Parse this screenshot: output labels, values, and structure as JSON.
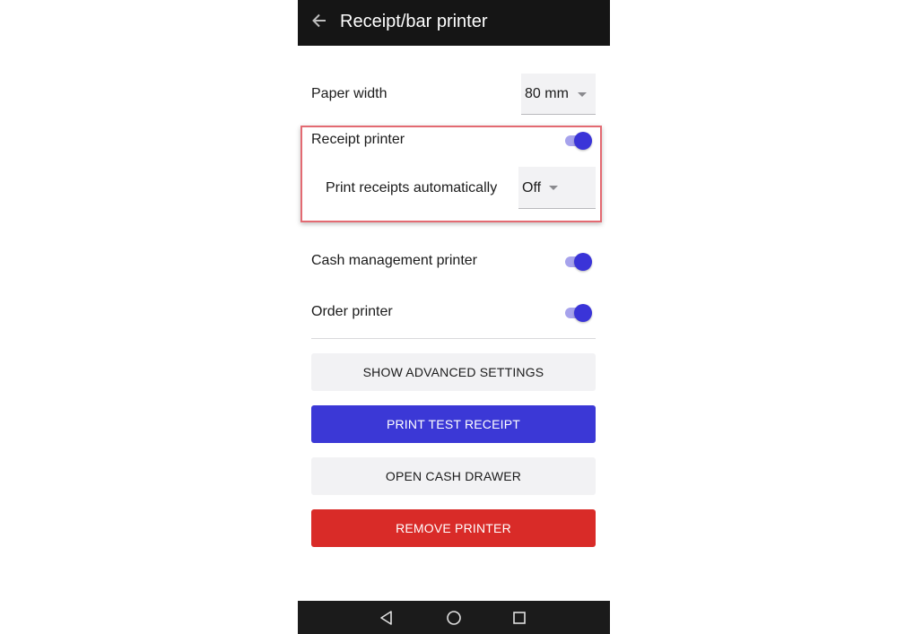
{
  "header": {
    "title": "Receipt/bar printer",
    "back_icon": "arrow-left-icon"
  },
  "paper_width": {
    "label": "Paper width",
    "value": "80 mm"
  },
  "receipt_printer": {
    "label": "Receipt printer",
    "enabled": true,
    "auto_print": {
      "label": "Print receipts automatically",
      "value": "Off"
    }
  },
  "cash_management_printer": {
    "label": "Cash management printer",
    "enabled": true
  },
  "order_printer": {
    "label": "Order printer",
    "enabled": true
  },
  "buttons": {
    "show_advanced": "SHOW ADVANCED SETTINGS",
    "print_test": "PRINT TEST RECEIPT",
    "open_drawer": "OPEN CASH DRAWER",
    "remove_printer": "REMOVE PRINTER"
  },
  "colors": {
    "accent": "#3b38d6",
    "danger": "#d92b28",
    "highlight": "#e36a72",
    "appbar": "#151515"
  },
  "navigation": {
    "back": "triangle-back-icon",
    "home": "circle-home-icon",
    "recents": "square-recents-icon"
  }
}
